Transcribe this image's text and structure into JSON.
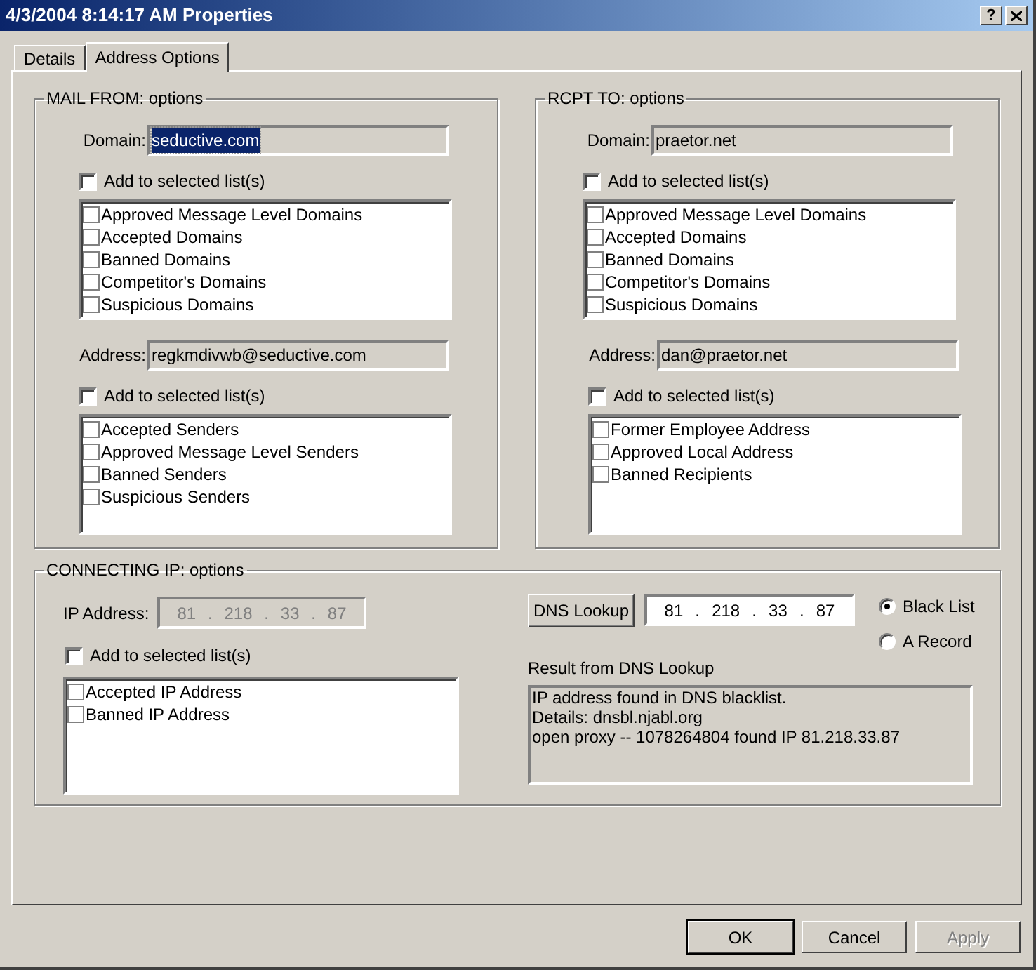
{
  "window": {
    "title": "4/3/2004 8:14:17 AM Properties",
    "help": "?"
  },
  "tabs": [
    {
      "label": "Details",
      "selected": false
    },
    {
      "label": "Address Options",
      "selected": true
    }
  ],
  "mail_from": {
    "title": "MAIL FROM: options",
    "groups": [
      {
        "field": {
          "label": "Domain:",
          "value": "seductive.com",
          "highlighted": true
        },
        "add": {
          "label": "Add to selected list(s)",
          "checked": false
        },
        "list": [
          {
            "label": "Approved Message Level Domains",
            "checked": false
          },
          {
            "label": "Accepted Domains",
            "checked": false
          },
          {
            "label": "Banned Domains",
            "checked": false
          },
          {
            "label": "Competitor's Domains",
            "checked": false
          },
          {
            "label": "Suspicious Domains",
            "checked": false
          }
        ]
      },
      {
        "field": {
          "label": "Address:",
          "value": "regkmdivwb@seductive.com",
          "highlighted": false
        },
        "add": {
          "label": "Add to selected list(s)",
          "checked": false
        },
        "list": [
          {
            "label": "Accepted Senders",
            "checked": false
          },
          {
            "label": "Approved Message Level Senders",
            "checked": false
          },
          {
            "label": "Banned Senders",
            "checked": false
          },
          {
            "label": "Suspicious Senders",
            "checked": false
          }
        ]
      }
    ]
  },
  "rcpt_to": {
    "title": "RCPT TO: options",
    "groups": [
      {
        "field": {
          "label": "Domain:",
          "value": "praetor.net",
          "highlighted": false
        },
        "add": {
          "label": "Add to selected list(s)",
          "checked": false
        },
        "list": [
          {
            "label": "Approved Message Level Domains",
            "checked": false
          },
          {
            "label": "Accepted Domains",
            "checked": false
          },
          {
            "label": "Banned Domains",
            "checked": false
          },
          {
            "label": "Competitor's Domains",
            "checked": false
          },
          {
            "label": "Suspicious Domains",
            "checked": false
          }
        ]
      },
      {
        "field": {
          "label": "Address:",
          "value": "dan@praetor.net",
          "highlighted": false
        },
        "add": {
          "label": "Add to selected list(s)",
          "checked": false
        },
        "list": [
          {
            "label": "Former Employee Address",
            "checked": false
          },
          {
            "label": "Approved Local Address",
            "checked": false
          },
          {
            "label": "Banned Recipients",
            "checked": false
          }
        ]
      }
    ]
  },
  "connecting_ip": {
    "title": "CONNECTING IP: options",
    "ip_address": {
      "label": "IP Address:",
      "octets": [
        "81",
        "218",
        "33",
        "87"
      ],
      "separator": ".",
      "disabled": true
    },
    "add": {
      "label": "Add to selected list(s)",
      "checked": false
    },
    "list": [
      {
        "label": "Accepted IP Address",
        "checked": false
      },
      {
        "label": "Banned IP Address",
        "checked": false
      }
    ],
    "dns_lookup": {
      "label": "DNS Lookup"
    },
    "lookup_ip": {
      "octets": [
        "81",
        "218",
        "33",
        "87"
      ],
      "separator": ".",
      "disabled": false
    },
    "lookup_type": [
      {
        "label": "Black List",
        "selected": true
      },
      {
        "label": "A Record",
        "selected": false
      }
    ],
    "result": {
      "label": "Result from DNS Lookup",
      "lines": [
        "IP address found in DNS blacklist.",
        "Details: dnsbl.njabl.org",
        "open proxy -- 1078264804 found IP 81.218.33.87"
      ]
    }
  },
  "buttons": [
    {
      "label": "OK",
      "default": true,
      "disabled": false
    },
    {
      "label": "Cancel",
      "default": false,
      "disabled": false
    },
    {
      "label": "Apply",
      "default": false,
      "disabled": true
    }
  ]
}
